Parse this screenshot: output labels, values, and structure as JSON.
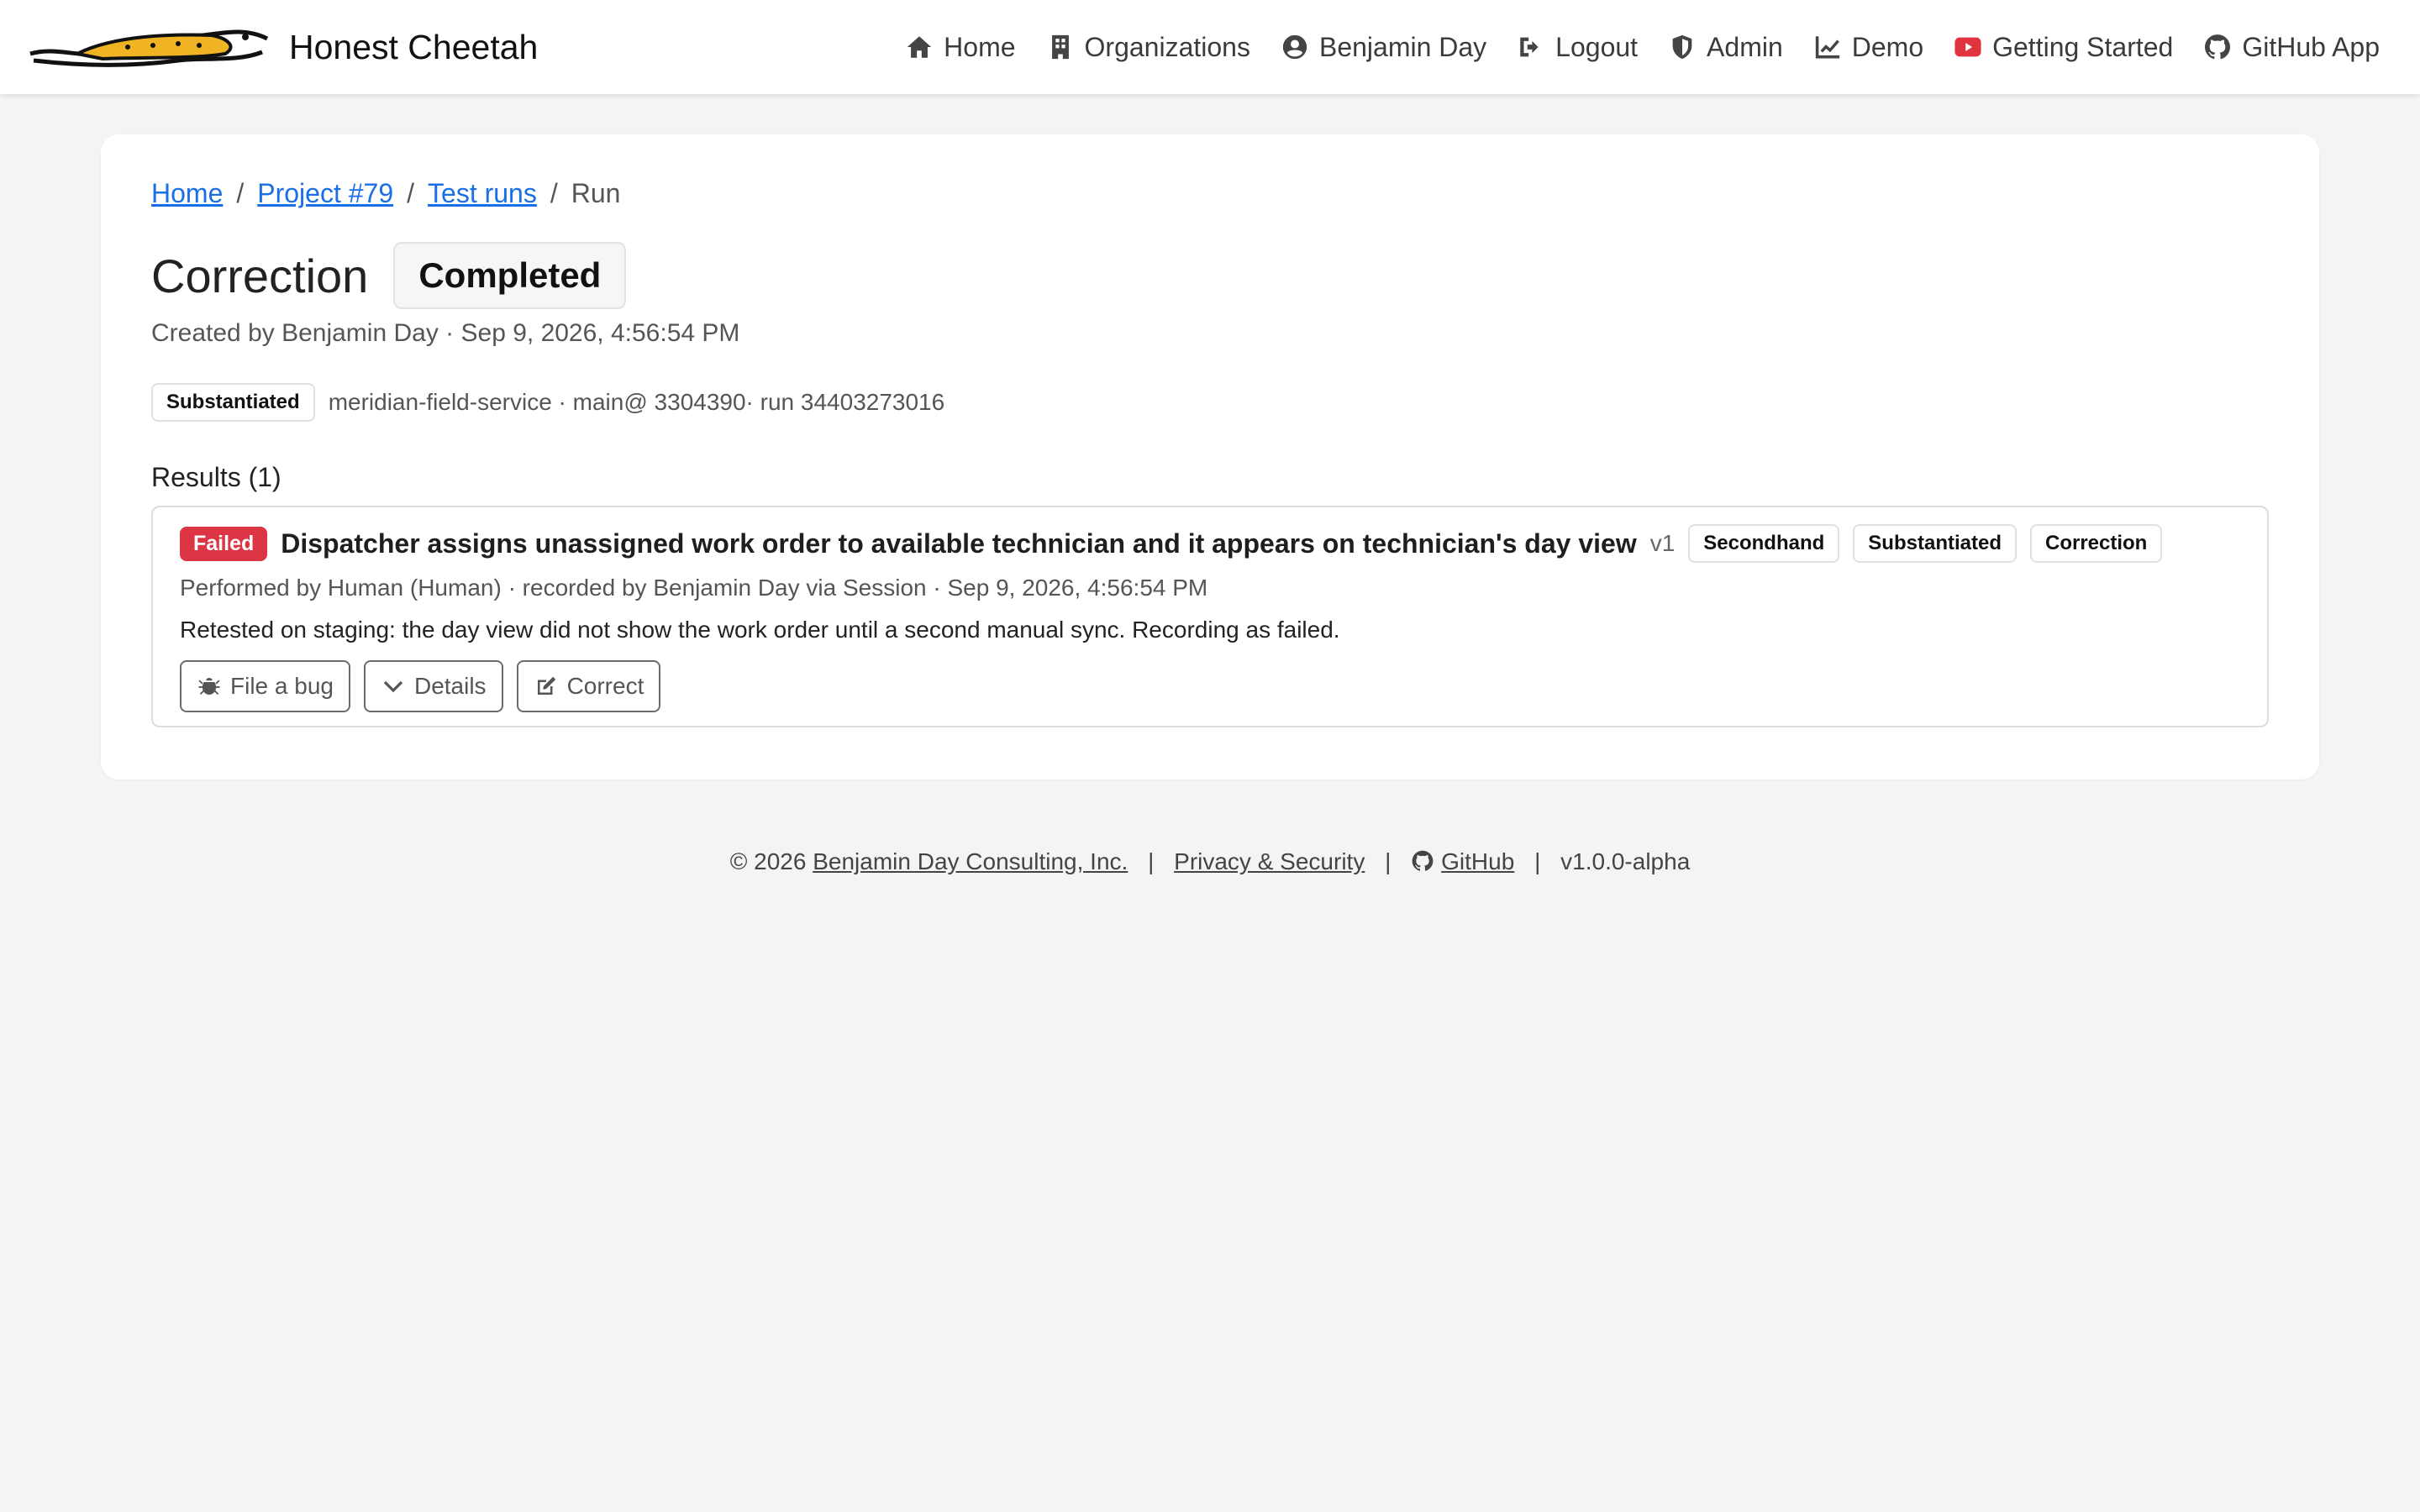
{
  "brand": {
    "name": "Honest Cheetah",
    "logo_icon": "cheetah-logo-icon",
    "accent": "#f0b323"
  },
  "nav": {
    "items": [
      {
        "label": "Home",
        "icon": "home-icon"
      },
      {
        "label": "Organizations",
        "icon": "building-icon"
      },
      {
        "label": "Benjamin Day",
        "icon": "user-circle-icon"
      },
      {
        "label": "Logout",
        "icon": "logout-icon"
      },
      {
        "label": "Admin",
        "icon": "shield-icon"
      },
      {
        "label": "Demo",
        "icon": "chart-line-icon"
      },
      {
        "label": "Getting Started",
        "icon": "youtube-icon"
      },
      {
        "label": "GitHub App",
        "icon": "github-icon"
      }
    ]
  },
  "breadcrumb": {
    "home": "Home",
    "project": "Project #79",
    "test_runs": "Test runs",
    "current": "Run",
    "separator": "/"
  },
  "run": {
    "title": "Correction",
    "status": "Completed",
    "created": "Created by Benjamin Day · Sep 9, 2026, 4:56:54 PM",
    "tag": "Substantiated",
    "meta": "meridian-field-service · main@ 3304390· run 34403273016"
  },
  "results": {
    "heading": "Results (1)",
    "items": [
      {
        "status": "Failed",
        "status_color": "#dc3545",
        "title": "Dispatcher assigns unassigned work order to available technician and it appears on technician's day view",
        "version": "v1",
        "tags": [
          "Secondhand",
          "Substantiated",
          "Correction"
        ],
        "performed": "Performed by Human (Human) · recorded by Benjamin Day via Session · Sep 9, 2026, 4:56:54 PM",
        "notes": "Retested on staging: the day view did not show the work order until a second manual sync. Recording as failed.",
        "actions": {
          "file_bug": "File a bug",
          "details": "Details",
          "correct": "Correct"
        }
      }
    ]
  },
  "footer": {
    "copyright": "© 2026",
    "company": "Benjamin Day Consulting, Inc.",
    "privacy": "Privacy & Security",
    "github": "GitHub",
    "version": "v1.0.0-alpha",
    "separator": "|"
  }
}
